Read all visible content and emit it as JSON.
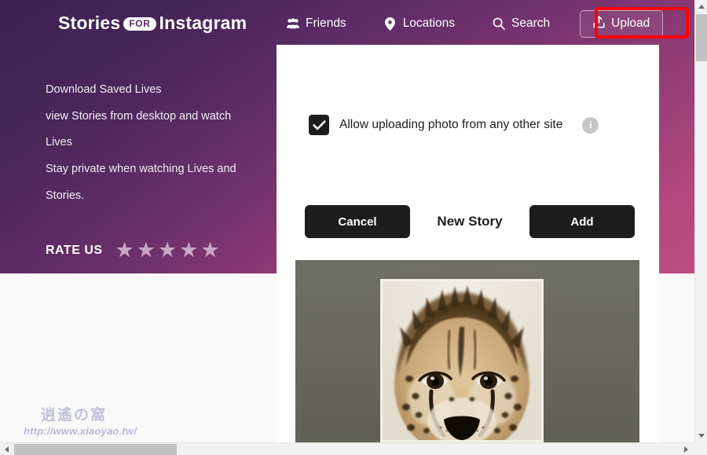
{
  "brand": {
    "part1": "Stories",
    "badge": "FOR",
    "part2": "Instagram"
  },
  "nav": {
    "items": [
      {
        "label": "Friends",
        "icon": "friends-icon"
      },
      {
        "label": "Locations",
        "icon": "location-pin-icon"
      },
      {
        "label": "Search",
        "icon": "search-icon"
      }
    ],
    "upload": {
      "label": "Upload",
      "icon": "upload-icon"
    }
  },
  "hero": {
    "lines": [
      "Download Saved Lives",
      "view Stories from desktop and watch",
      "Lives",
      "Stay private when watching Lives and",
      "Stories."
    ],
    "rate_label": "RATE US",
    "stars": [
      "★",
      "★",
      "★",
      "★",
      "★"
    ],
    "star_color": "#c9a6c6"
  },
  "watermark": {
    "glyphs": "逍遙の窩",
    "url": "http://www.xiaoyao.tw/"
  },
  "modal": {
    "checkbox": {
      "label": "Allow uploading photo from any other site",
      "checked": true,
      "info_icon": "info-icon",
      "info_glyph": "i"
    },
    "buttons": {
      "cancel": "Cancel",
      "title": "New Story",
      "add": "Add"
    },
    "preview": {
      "alt": "cheetah-cub-photo",
      "crop_frame": "crop-selection-frame"
    }
  },
  "annotation": {
    "highlight_color": "#fd0000",
    "target": "Upload"
  },
  "scrollbars": {
    "vertical": {
      "up": "▲",
      "down": "▼"
    },
    "horizontal": {
      "left": "◀",
      "right": "▶"
    }
  }
}
